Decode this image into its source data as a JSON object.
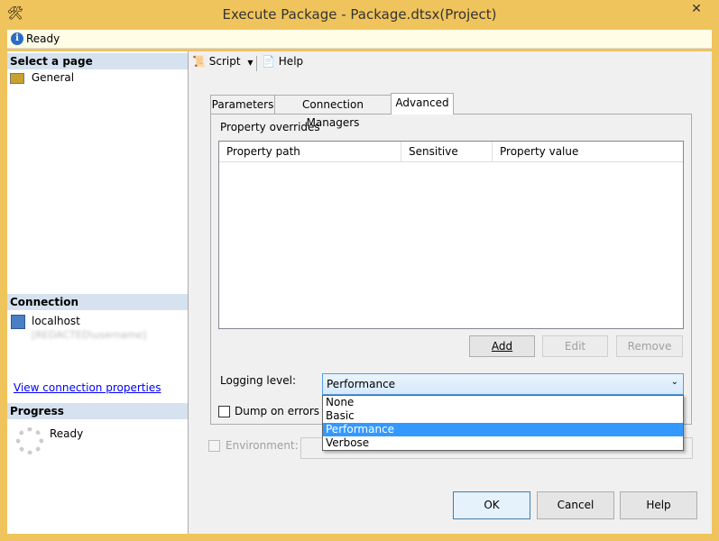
{
  "window": {
    "title": "Execute Package - Package.dtsx(Project)",
    "close": "✕"
  },
  "status": {
    "text": "Ready"
  },
  "left": {
    "select_header": "Select a page",
    "pages": [
      {
        "label": "General"
      }
    ],
    "connection_header": "Connection",
    "server": "localhost",
    "user": "[REDACTED\\username]",
    "link": "View connection properties",
    "progress_header": "Progress",
    "progress_status": "Ready"
  },
  "toolbar": {
    "script": "Script",
    "help": "Help"
  },
  "tabs": [
    {
      "label": "Parameters"
    },
    {
      "label": "Connection Managers"
    },
    {
      "label": "Advanced",
      "selected": true
    }
  ],
  "advanced": {
    "overrides_label": "Property overrides",
    "columns": [
      "Property path",
      "Sensitive",
      "Property value"
    ],
    "rows": [],
    "add": "Add",
    "edit": "Edit",
    "remove": "Remove",
    "logging_label": "Logging level:",
    "logging_value": "Performance",
    "logging_options": [
      "None",
      "Basic",
      "Performance",
      "Verbose"
    ],
    "dump_label": "Dump on errors",
    "dump_checked": false
  },
  "environment": {
    "label": "Environment:",
    "checked": false,
    "enabled": false
  },
  "buttons": {
    "ok": "OK",
    "cancel": "Cancel",
    "help": "Help"
  },
  "colors": {
    "frame": "#f0c45c",
    "selection": "#3399ff",
    "header": "#d6e2ef",
    "link": "#0000ff"
  }
}
